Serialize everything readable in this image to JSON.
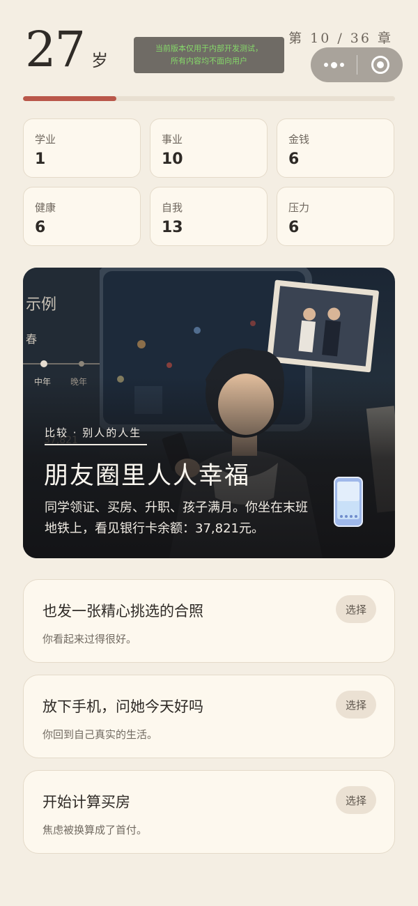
{
  "header": {
    "age": "27",
    "age_unit": "岁",
    "chapter": "第 10 / 36 章",
    "dev_notice": [
      "当前版本仅用于内部开发测试，",
      "所有内容均不面向用户"
    ]
  },
  "progress": {
    "current_chapter": 10,
    "total_chapters": 36,
    "fraction": 0.25,
    "color": "#b9574a"
  },
  "stats": [
    {
      "label": "学业",
      "value": "1"
    },
    {
      "label": "事业",
      "value": "10"
    },
    {
      "label": "金钱",
      "value": "6"
    },
    {
      "label": "健康",
      "value": "6"
    },
    {
      "label": "自我",
      "value": "13"
    },
    {
      "label": "压力",
      "value": "6"
    }
  ],
  "story": {
    "tag": "比较 · 别人的人生",
    "title": "朋友圈里人人幸福",
    "description": "同学领证、买房、升职、孩子满月。你坐在末班地铁上，看见银行卡余额：37,821元。",
    "bg_text": {
      "label": "示例",
      "spring": "春",
      "mid": "中年",
      "late": "晚年",
      "amount": "37,821"
    }
  },
  "choices": [
    {
      "title": "也发一张精心挑选的合照",
      "subtitle": "你看起来过得很好。",
      "button": "选择"
    },
    {
      "title": "放下手机，问她今天好吗",
      "subtitle": "你回到自己真实的生活。",
      "button": "选择"
    },
    {
      "title": "开始计算买房",
      "subtitle": "焦虑被换算成了首付。",
      "button": "选择"
    }
  ],
  "colors": {
    "background": "#f4eee3",
    "card": "#fdf8ee",
    "accent": "#b9574a",
    "notice_text": "#86d96a"
  }
}
